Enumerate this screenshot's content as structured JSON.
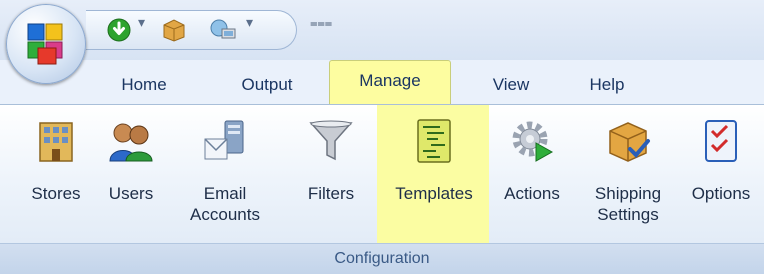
{
  "app": {
    "orb_icon": "colored-cubes-logo",
    "colors": {
      "tab_active_bg": "#fdfda0",
      "highlight": "#fbfda2",
      "text": "#1b3662"
    }
  },
  "quick_access": {
    "items": [
      "download-icon",
      "package-icon",
      "globe-computer-icon"
    ],
    "customize_glyph": "⩶"
  },
  "tabs": {
    "home": "Home",
    "output": "Output",
    "manage": "Manage",
    "view": "View",
    "help": "Help",
    "active": "Manage"
  },
  "ribbon": {
    "buttons": {
      "stores": "Stores",
      "users": "Users",
      "email_line1": "Email",
      "email_line2": "Accounts",
      "filters": "Filters",
      "templates": "Templates",
      "actions": "Actions",
      "shipping_line1": "Shipping",
      "shipping_line2": "Settings",
      "options": "Options"
    },
    "highlighted": "Templates",
    "group_label": "Configuration"
  }
}
